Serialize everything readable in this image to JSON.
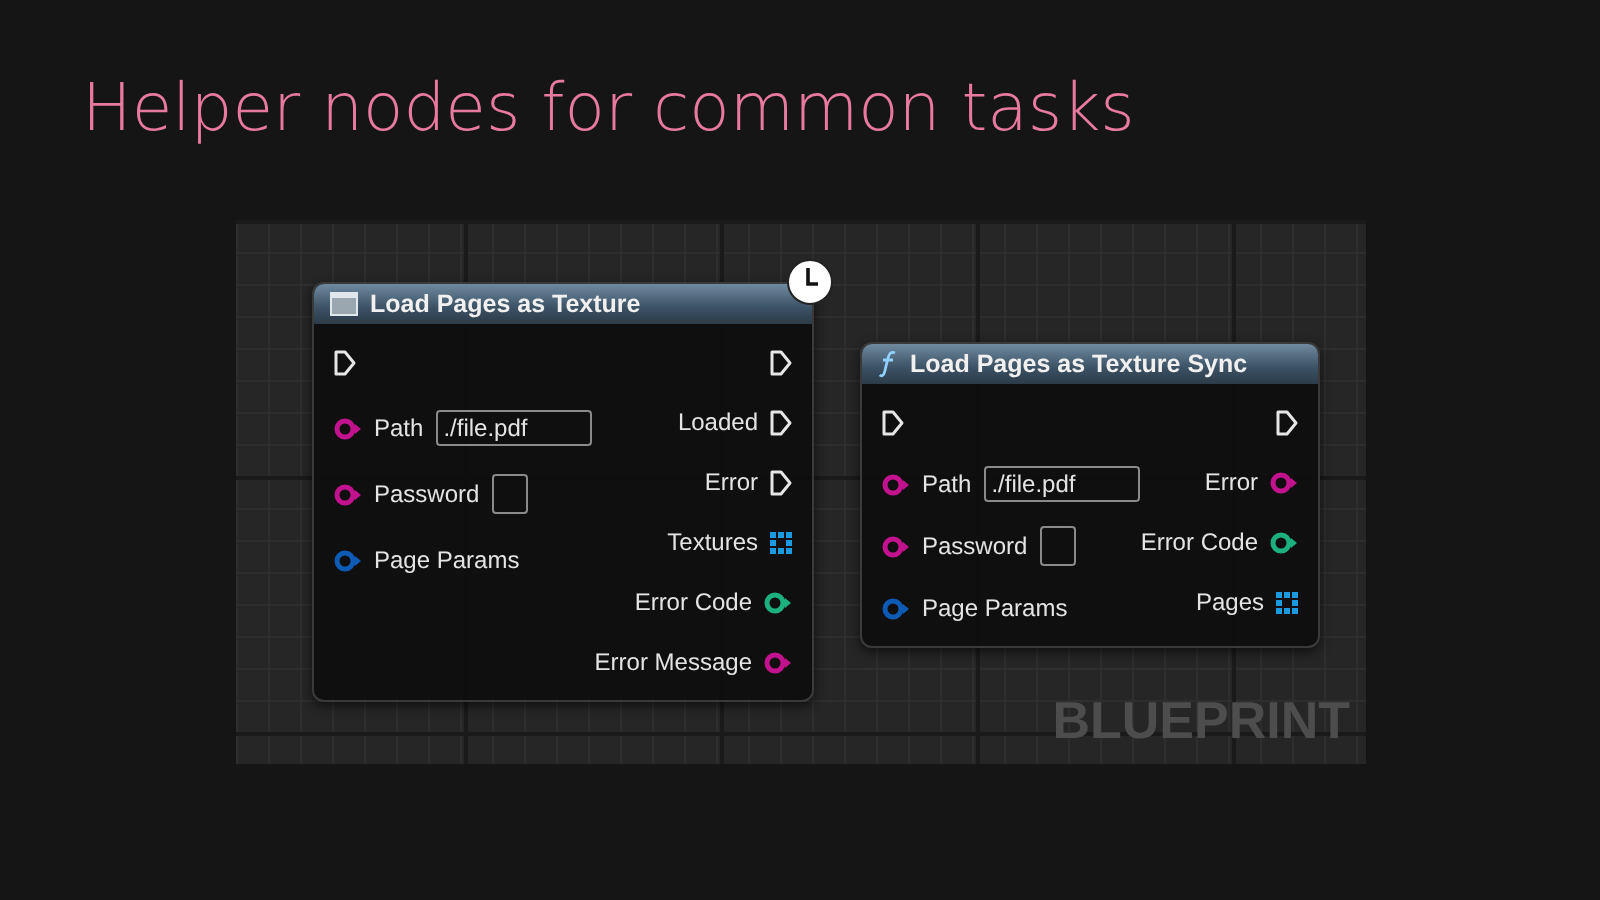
{
  "slide": {
    "title": "Helper nodes for common tasks"
  },
  "canvas": {
    "watermark": "BLUEPRINT"
  },
  "nodes": [
    {
      "title": "Load Pages as Texture",
      "kind": "event",
      "latent": true,
      "inputs": [
        {
          "kind": "exec"
        },
        {
          "kind": "data",
          "label": "Path",
          "color": "#c2128e",
          "value": "./file.pdf"
        },
        {
          "kind": "data",
          "label": "Password",
          "color": "#c2128e",
          "has_field": true
        },
        {
          "kind": "data",
          "label": "Page Params",
          "color": "#0e5bb5"
        }
      ],
      "outputs": [
        {
          "kind": "exec"
        },
        {
          "kind": "exec",
          "label": "Loaded"
        },
        {
          "kind": "exec",
          "label": "Error"
        },
        {
          "kind": "array",
          "label": "Textures",
          "color": "#1a9be0"
        },
        {
          "kind": "data",
          "label": "Error Code",
          "color": "#1db07f"
        },
        {
          "kind": "data",
          "label": "Error Message",
          "color": "#c2128e"
        }
      ]
    },
    {
      "title": "Load Pages as Texture Sync",
      "kind": "function",
      "latent": false,
      "inputs": [
        {
          "kind": "exec"
        },
        {
          "kind": "data",
          "label": "Path",
          "color": "#c2128e",
          "value": "./file.pdf"
        },
        {
          "kind": "data",
          "label": "Password",
          "color": "#c2128e",
          "has_field": true
        },
        {
          "kind": "data",
          "label": "Page Params",
          "color": "#0e5bb5"
        }
      ],
      "outputs": [
        {
          "kind": "exec"
        },
        {
          "kind": "data",
          "label": "Error",
          "color": "#c2128e"
        },
        {
          "kind": "data",
          "label": "Error Code",
          "color": "#1db07f"
        },
        {
          "kind": "array",
          "label": "Pages",
          "color": "#1a9be0"
        }
      ]
    }
  ]
}
